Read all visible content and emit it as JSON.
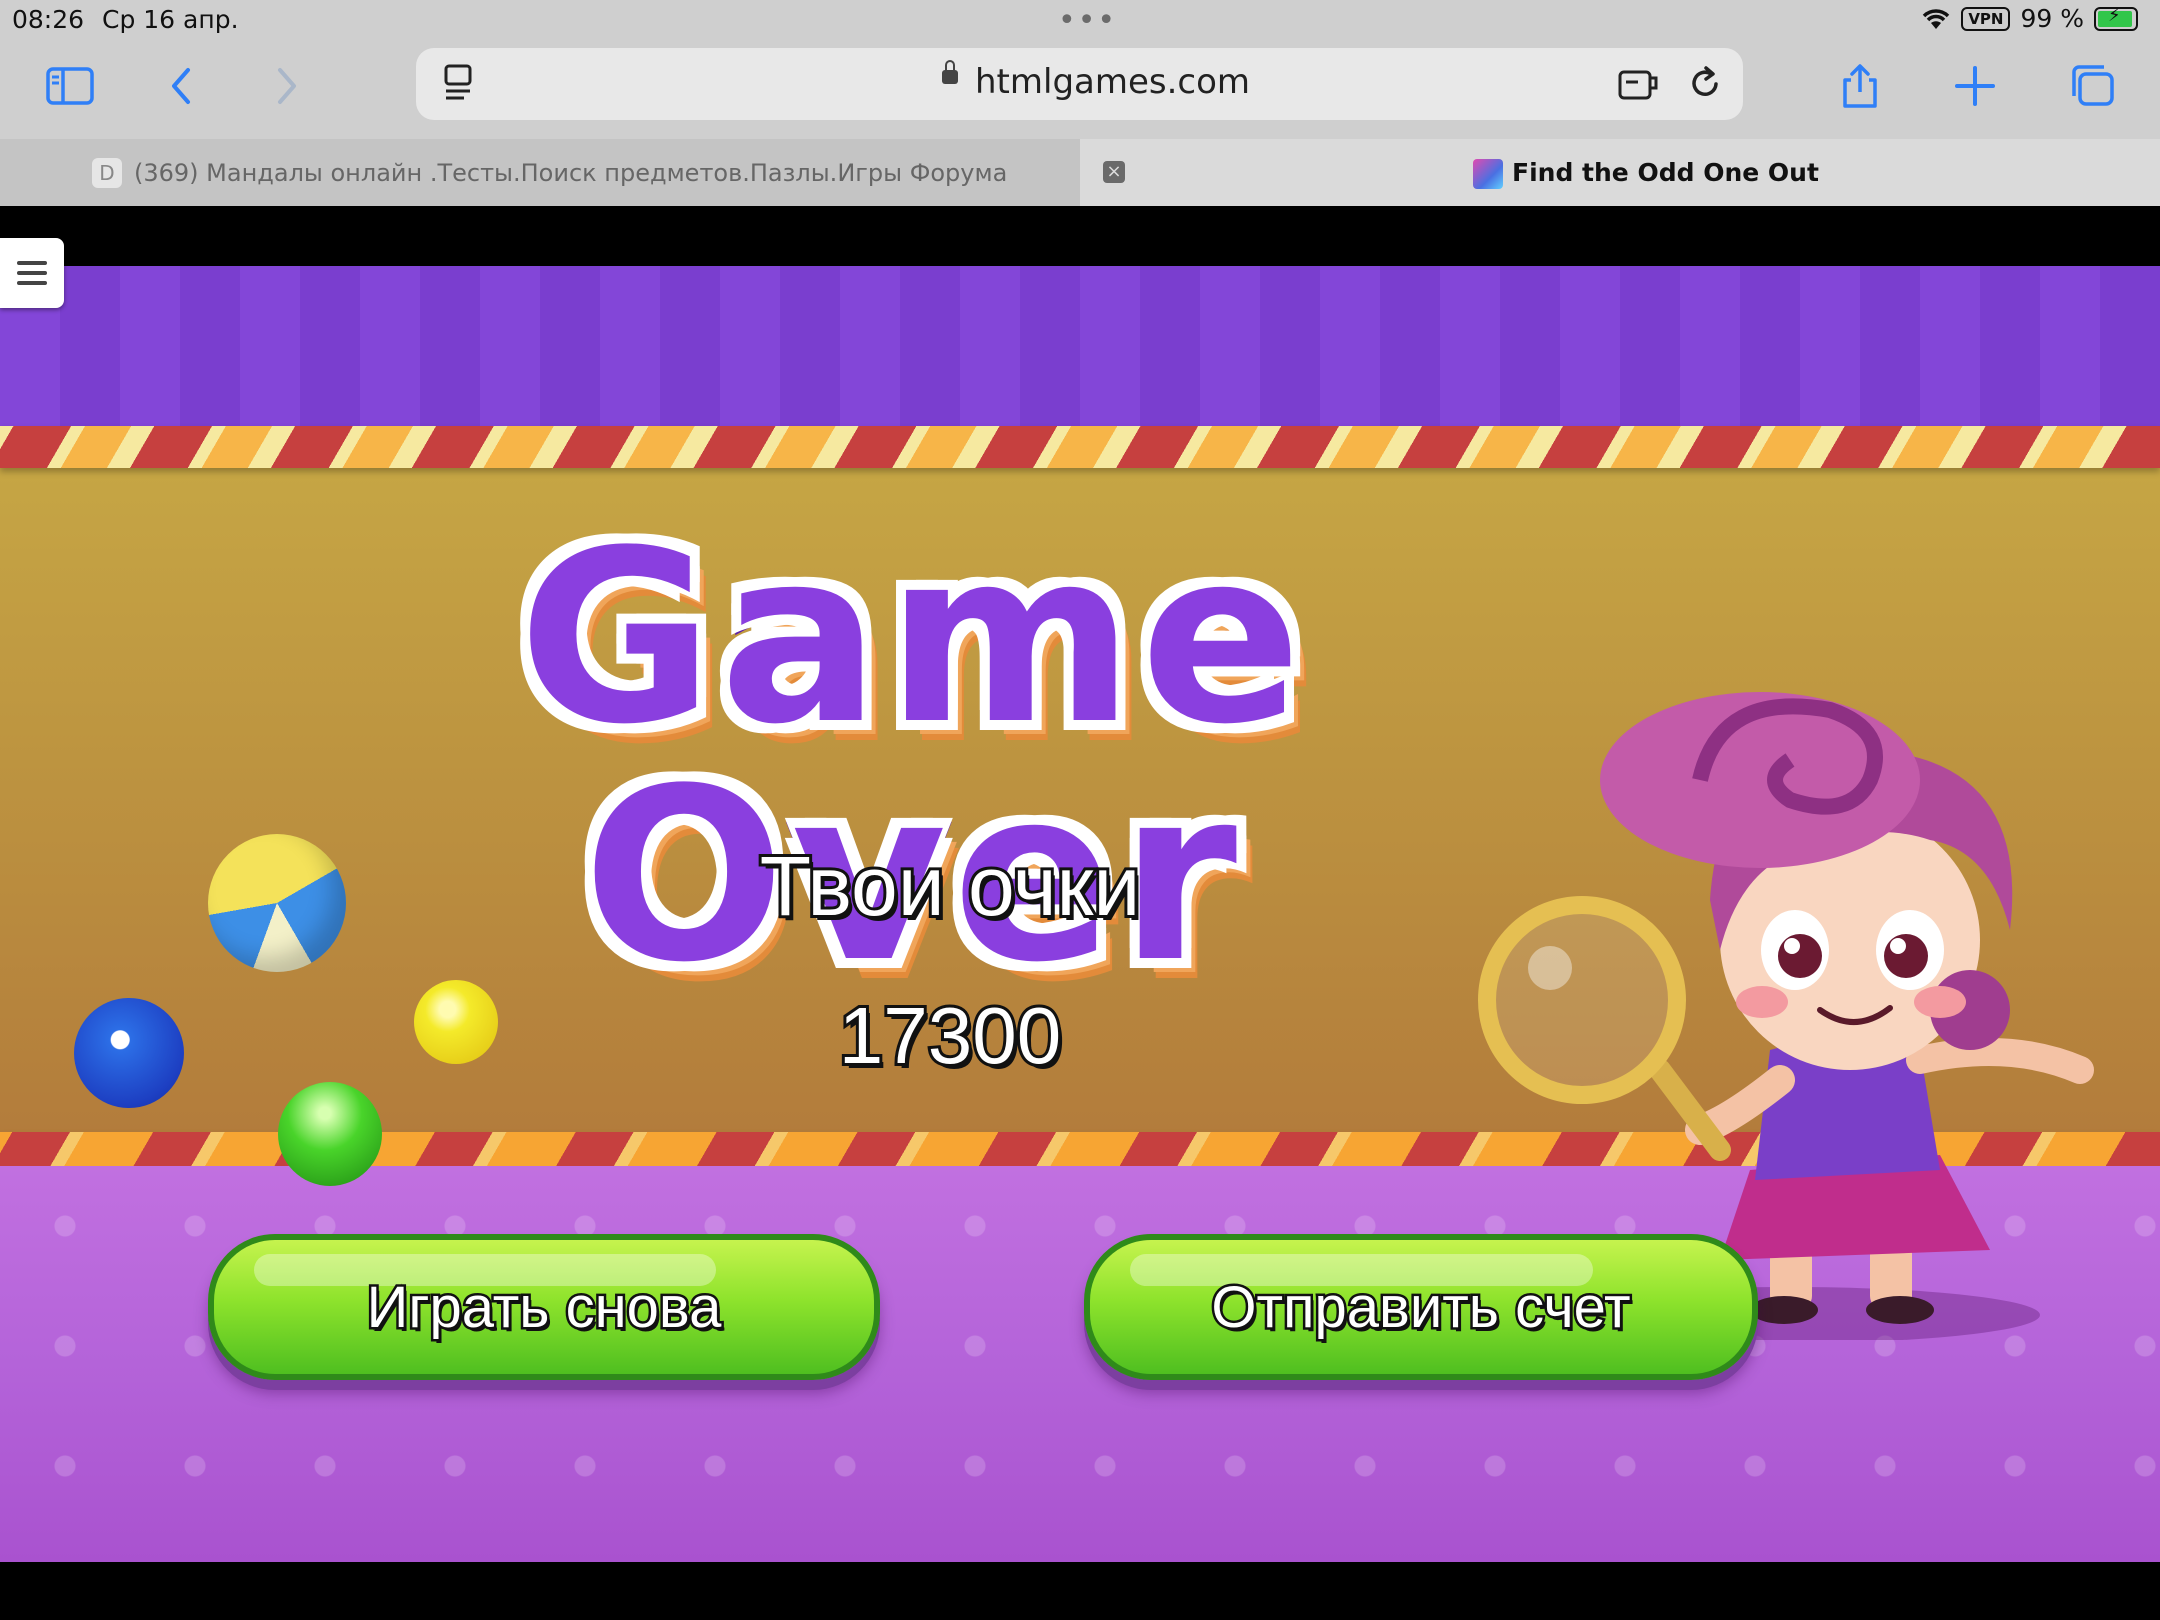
{
  "status_bar": {
    "time": "08:26",
    "date": "Ср 16 апр.",
    "vpn": "VPN",
    "battery": "99 %"
  },
  "browser": {
    "url": "htmlgames.com",
    "accent_color": "#2f7ff7",
    "tabs": [
      {
        "favicon": "D",
        "title": "(369) Мандалы онлайн .Тесты.Поиск предметов.Пазлы.Игры Форума"
      },
      {
        "title": "Find the Odd One Out"
      }
    ]
  },
  "game": {
    "heading": "Game Over",
    "score_label": "Твои очки",
    "score_value": "17300",
    "buttons": {
      "play_again": "Играть снова",
      "submit_score": "Отправить счет"
    }
  }
}
